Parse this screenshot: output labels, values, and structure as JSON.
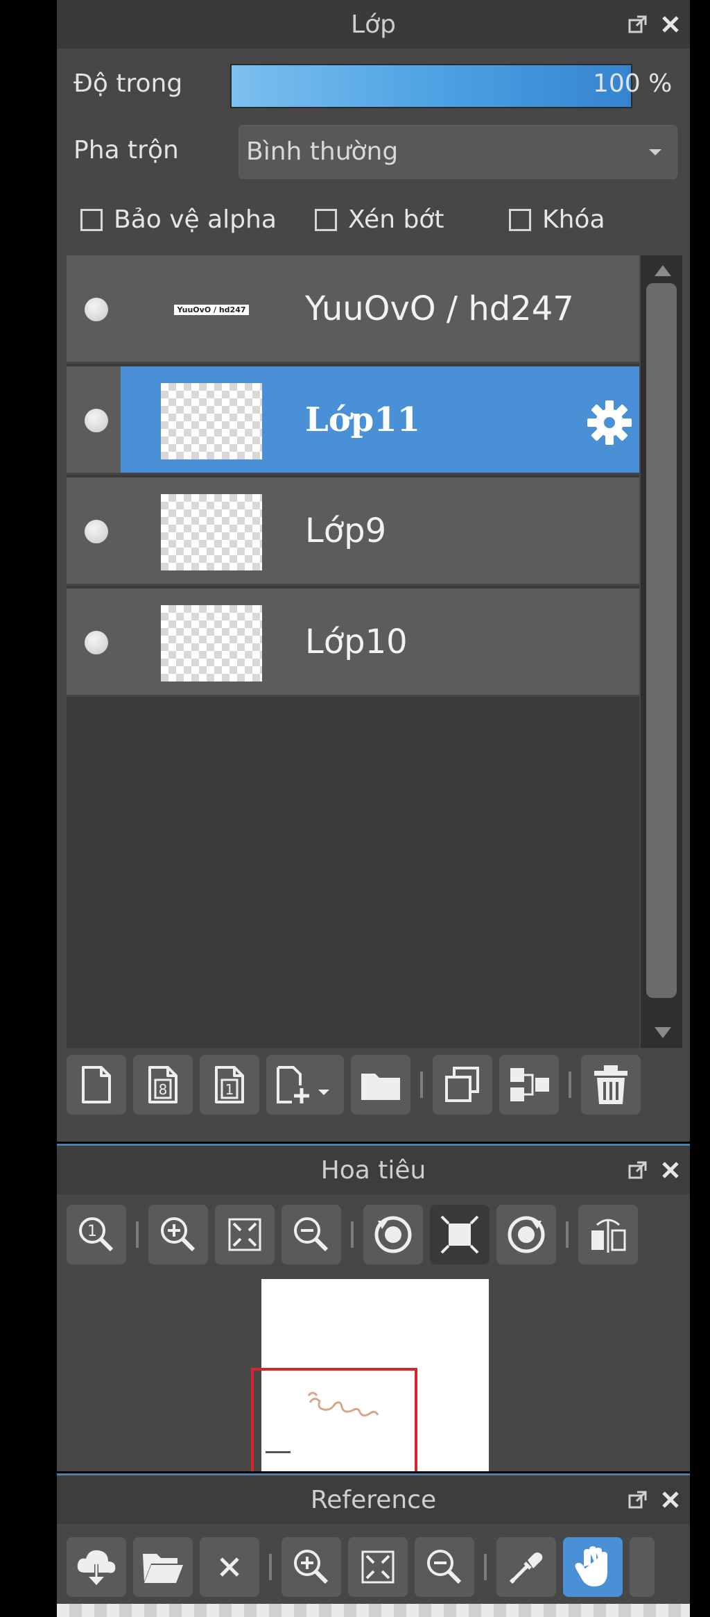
{
  "layer_panel": {
    "title": "Lớp",
    "opacity_label": "Độ trong",
    "opacity_value": "100 %",
    "opacity_fraction": 1.0,
    "blend_label": "Pha trộn",
    "blend_value": "Bình thường",
    "checkboxes": [
      {
        "label": "Bảo vệ alpha",
        "checked": false
      },
      {
        "label": "Xén bớt",
        "checked": false
      },
      {
        "label": "Khóa",
        "checked": false
      }
    ],
    "layers": [
      {
        "name": "YuuOvO / hd247",
        "selected": false,
        "thumb_text": "YuuOvO / hd247"
      },
      {
        "name": "Lớp11",
        "selected": true
      },
      {
        "name": "Lớp9",
        "selected": false
      },
      {
        "name": "Lớp10",
        "selected": false
      }
    ],
    "tools": [
      {
        "icon": "new-layer-icon"
      },
      {
        "icon": "new-8bit-layer-icon",
        "glyph": "8"
      },
      {
        "icon": "new-1bit-layer-icon",
        "glyph": "1"
      },
      {
        "icon": "add-layer-dropdown-icon"
      },
      {
        "icon": "folder-icon"
      },
      {
        "icon": "duplicate-layer-icon"
      },
      {
        "icon": "merge-down-icon"
      },
      {
        "icon": "delete-icon"
      }
    ]
  },
  "navigator_panel": {
    "title": "Hoa tiêu",
    "tools": [
      {
        "icon": "zoom-actual-size-icon",
        "glyph": "1"
      },
      {
        "icon": "zoom-in-icon"
      },
      {
        "icon": "fit-to-window-icon"
      },
      {
        "icon": "zoom-out-icon"
      },
      {
        "icon": "rotate-left-icon"
      },
      {
        "icon": "reset-view-icon"
      },
      {
        "icon": "rotate-right-icon"
      },
      {
        "icon": "flip-horizontal-icon"
      }
    ],
    "accent_color": "#d7262e"
  },
  "reference_panel": {
    "title": "Reference",
    "tools": [
      {
        "icon": "cloud-download-icon"
      },
      {
        "icon": "open-folder-icon"
      },
      {
        "icon": "close-icon"
      },
      {
        "icon": "zoom-in-icon"
      },
      {
        "icon": "fit-to-window-icon"
      },
      {
        "icon": "zoom-out-icon"
      },
      {
        "icon": "eyedropper-icon"
      },
      {
        "icon": "hand-icon",
        "active": true
      }
    ]
  },
  "colors": {
    "panel_bg": "#474747",
    "selection": "#4a90d6",
    "accent_line": "#4d7fae"
  }
}
